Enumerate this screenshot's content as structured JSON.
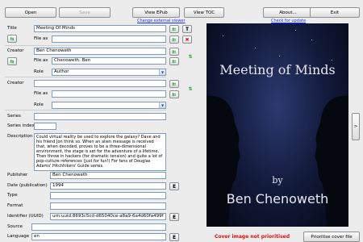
{
  "toolbar": {
    "open": "Open",
    "save": "Save",
    "view_epub": "View EPub",
    "view_toc": "View TOC",
    "about": "About...",
    "exit": "Exit",
    "change_viewer": "Change external viewer",
    "check_update": "Check for update"
  },
  "form": {
    "title_label": "Title",
    "title_value": "Meeting Of Minds",
    "file_as_label": "File as",
    "title_file_as": "",
    "creator_label": "Creator",
    "creator_value": "Ben Chenoweth",
    "creator_file_as": "Chenoweth, Ben",
    "role_label": "Role",
    "role_value": "Author",
    "creator2_value": "",
    "creator2_file_as": "",
    "role2_value": "",
    "series_label": "Series",
    "series_value": "",
    "series_index_label": "Series index",
    "series_index_value": "",
    "description_label": "Description",
    "description_value": "Could virtual reality be used to explore the galaxy? Dave and his friend Jon think so. When an alien message is received that, when decoded, proves to be a three-dimensional environment, the stage is set for the adventure of a lifetime. Then throw in hackers (for dramatic tension) and quite a lot of pop-culture references (just for fun!) For fans of Douglas Adams' Hitchhikers' Guide series.",
    "publisher_label": "Publisher",
    "publisher_value": "Ben Chenoweth",
    "date_label": "Date (publication)",
    "date_value": "1994",
    "type_label": "Type",
    "type_value": "",
    "format_label": "Format",
    "format_value": "",
    "identifier_label": "Identifier (UUID)",
    "identifier_value": "urn:uuid:8693c5cd-d65040ce-a8a9-6a4d60fa499f",
    "source_label": "Source",
    "source_value": "",
    "language_label": "Language",
    "language_value": "en",
    "e_button": "E",
    "t_button": "T"
  },
  "cover": {
    "title_line": "Meeting of Minds",
    "by": "by",
    "author": "Ben Chenoweth",
    "status": "Cover image not prioritised",
    "status_color": "#e01010",
    "prioritise_button": "Prioritise cover file",
    "next_button": ">"
  },
  "icons": {
    "swap": "swap-icon",
    "copy": "copy-to-file-as-icon",
    "delete": "delete-icon",
    "reorder": "reorder-icon"
  }
}
